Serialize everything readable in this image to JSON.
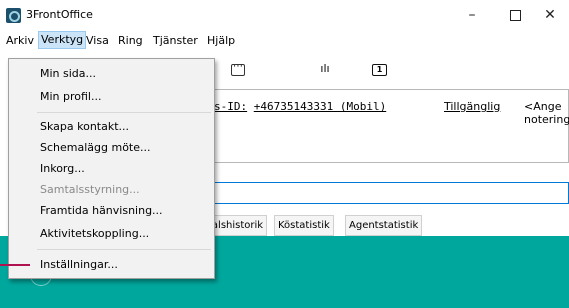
{
  "window": {
    "title": "3FrontOffice",
    "minimize_glyph": "–",
    "close_glyph": "✕"
  },
  "menubar": {
    "items": [
      "Arkiv",
      "Verktyg",
      "Visa",
      "Ring",
      "Tjänster",
      "Hjälp"
    ],
    "active": "Verktyg"
  },
  "toolbar": {
    "icons": [
      "calendar-icon",
      "voice-icon",
      "queue-one-icon"
    ],
    "one_label": "1",
    "voice_glyph": "ılı"
  },
  "dropdown": {
    "items": [
      {
        "label": "Min sida...",
        "enabled": true
      },
      {
        "label": "Min profil...",
        "enabled": true
      },
      {
        "label": "Skapa kontakt...",
        "enabled": true
      },
      {
        "label": "Schemalägg möte...",
        "enabled": true
      },
      {
        "label": "Inkorg...",
        "enabled": true
      },
      {
        "label": "Samtalsstyrning...",
        "enabled": false
      },
      {
        "label": "Framtida hänvisning...",
        "enabled": true
      },
      {
        "label": "Aktivitetskoppling...",
        "enabled": true
      },
      {
        "label": "Inställningar...",
        "enabled": true
      }
    ]
  },
  "status": {
    "id_prefix": "s-ID:",
    "number_text": "+46735143331 (Mobil)",
    "availability": "Tillgänglig",
    "note_placeholder": "<Ange notering"
  },
  "tabs": [
    "talshistorik",
    "Köstatistik",
    "Agentstatistik"
  ],
  "colors": {
    "teal_background": "#00a79d",
    "menu_highlight": "#cce4f7",
    "pointer_line": "#b0124f",
    "search_border": "#0078d7"
  }
}
